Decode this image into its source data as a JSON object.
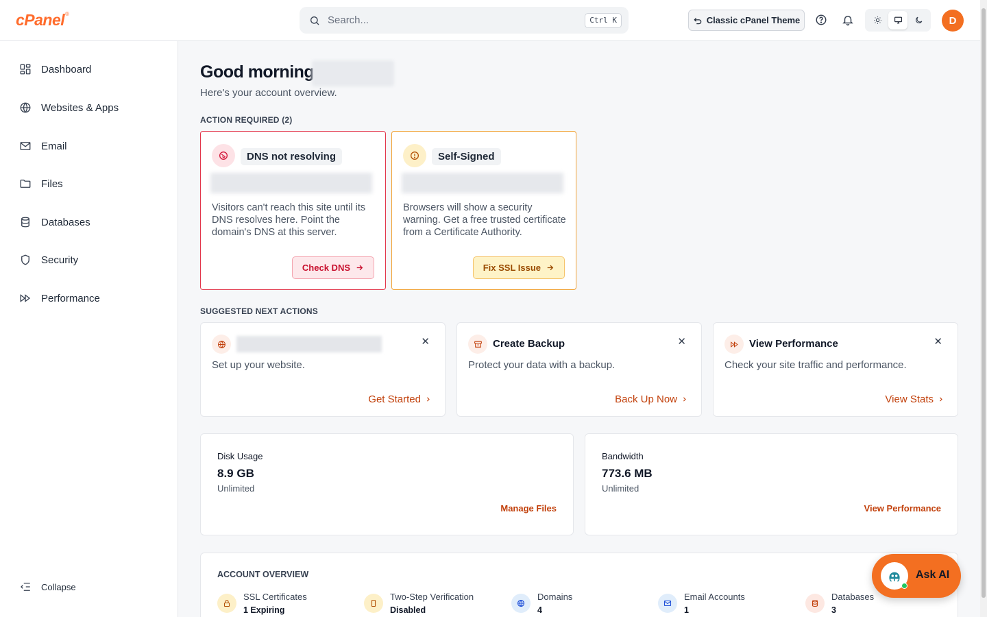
{
  "header": {
    "logo": "cPanel",
    "logo_mark": "®",
    "search_placeholder": "Search...",
    "search_shortcut": "Ctrl K",
    "classic_theme_label": "Classic cPanel Theme",
    "avatar_initial": "D"
  },
  "sidebar": {
    "items": [
      {
        "label": "Dashboard",
        "icon": "dashboard-icon"
      },
      {
        "label": "Websites & Apps",
        "icon": "globe-icon"
      },
      {
        "label": "Email",
        "icon": "mail-icon"
      },
      {
        "label": "Files",
        "icon": "folder-icon"
      },
      {
        "label": "Databases",
        "icon": "database-icon"
      },
      {
        "label": "Security",
        "icon": "shield-icon"
      },
      {
        "label": "Performance",
        "icon": "fast-forward-icon"
      }
    ],
    "collapse_label": "Collapse"
  },
  "main": {
    "greeting": "Good morning",
    "subtitle": "Here's your account overview.",
    "action_required_label": "ACTION REQUIRED (2)",
    "alerts": [
      {
        "title": "DNS not resolving",
        "description": "Visitors can't reach this site until its DNS resolves here. Point the domain's DNS at this server.",
        "cta": "Check DNS",
        "color": "#e2364b"
      },
      {
        "title": "Self-Signed",
        "description": "Browsers will show a security warning. Get a free trusted certificate from a Certificate Authority.",
        "cta": "Fix SSL Issue",
        "color": "#f0a133"
      }
    ],
    "suggested_label": "SUGGESTED NEXT ACTIONS",
    "suggestions": [
      {
        "title": "",
        "description": "Set up your website.",
        "link": "Get Started"
      },
      {
        "title": "Create Backup",
        "description": "Protect your data with a backup.",
        "link": "Back Up Now"
      },
      {
        "title": "View Performance",
        "description": "Check your site traffic and performance.",
        "link": "View Stats"
      }
    ],
    "usage": [
      {
        "label": "Disk Usage",
        "value": "8.9 GB",
        "limit": "Unlimited",
        "link": "Manage Files"
      },
      {
        "label": "Bandwidth",
        "value": "773.6 MB",
        "limit": "Unlimited",
        "link": "View Performance"
      }
    ],
    "overview": {
      "title": "ACCOUNT OVERVIEW",
      "items": [
        {
          "label": "SSL Certificates",
          "value": "1 Expiring"
        },
        {
          "label": "Two-Step Verification",
          "value": "Disabled"
        },
        {
          "label": "Domains",
          "value": "4"
        },
        {
          "label": "Email Accounts",
          "value": "1"
        },
        {
          "label": "Databases",
          "value": "3"
        }
      ]
    }
  },
  "ask_ai": {
    "label": "Ask AI"
  },
  "colors": {
    "brand": "#ff6c2c",
    "accent": "#f36f21",
    "link": "#c2410c",
    "danger": "#e2364b",
    "warning": "#f0a133"
  }
}
